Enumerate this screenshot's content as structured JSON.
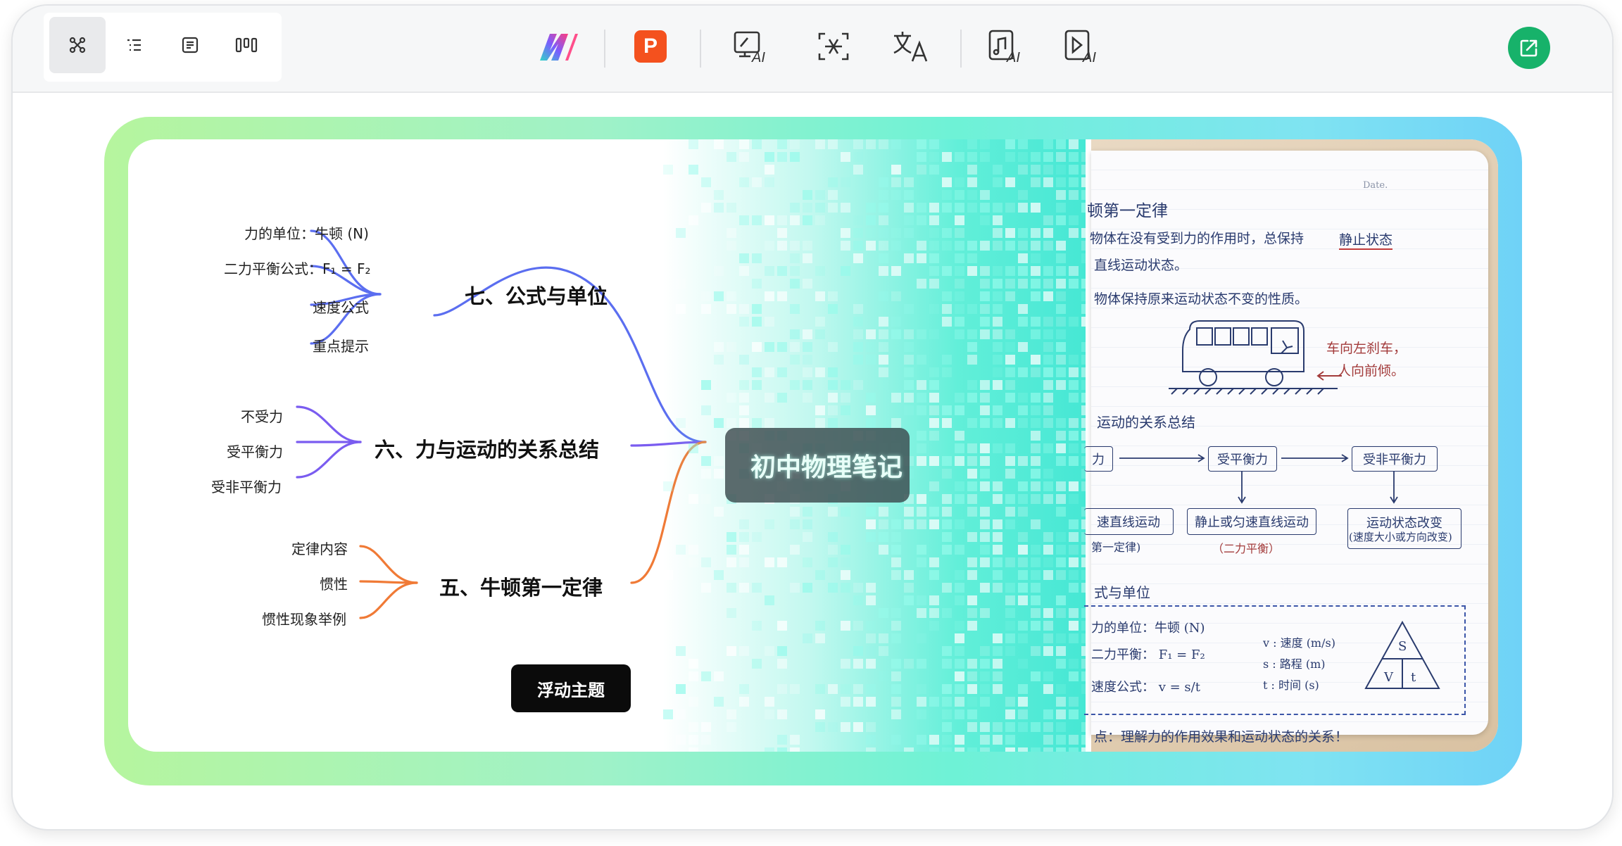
{
  "toolbar": {
    "view_modes": [
      {
        "icon": "mindmap-view-icon",
        "active": true
      },
      {
        "icon": "outline-view-icon",
        "active": false
      },
      {
        "icon": "card-view-icon",
        "active": false
      },
      {
        "icon": "board-view-icon",
        "active": false
      }
    ],
    "tools": [
      {
        "icon": "app-logo-icon"
      },
      {
        "icon": "ppt-icon",
        "label": "P"
      },
      {
        "icon": "ai-generate-icon",
        "badge": "AI"
      },
      {
        "icon": "ocr-scan-icon"
      },
      {
        "icon": "translate-icon"
      },
      {
        "icon": "ai-audio-icon",
        "badge": "AI"
      },
      {
        "icon": "ai-video-icon",
        "badge": "AI"
      }
    ],
    "share_icon": "share-export-icon"
  },
  "colors": {
    "branch7": "#5b6ef0",
    "branch6": "#7a5cf0",
    "branch5": "#f07a36",
    "share": "#17b26a",
    "ppt": "#f4511e"
  },
  "mindmap": {
    "central": "初中物理笔记",
    "branches": [
      {
        "title": "七、公式与单位",
        "leaves": [
          "力的单位：牛顿 (N)",
          "二力平衡公式：F₁ = F₂",
          "速度公式",
          "重点提示"
        ]
      },
      {
        "title": "六、力与运动的关系总结",
        "leaves": [
          "不受力",
          "受平衡力",
          "受非平衡力"
        ]
      },
      {
        "title": "五、牛顿第一定律",
        "leaves": [
          "定律内容",
          "惯性",
          "惯性现象举例"
        ]
      }
    ],
    "floating_topic": "浮动主题"
  },
  "notebook": {
    "date_label": "Date.",
    "heading1": "顿第一定律",
    "line1a": "物体在没有受到力的作用时，总保持",
    "line1b": "静止状态",
    "line2": "直线运动状态。",
    "line3": "物体保持原来运动状态不变的性质。",
    "bus_note1": "车向左刹车，",
    "bus_note2": "人向前倾。",
    "heading2": "运动的关系总结",
    "flow": [
      "力",
      "受平衡力",
      "受非平衡力"
    ],
    "flow_results": [
      "速直线运动",
      "静止或匀速直线运动",
      "运动状态改变"
    ],
    "flow_notes": [
      "第一定律)",
      "（二力平衡）",
      "(速度大小或方向改变)"
    ],
    "heading3": "式与单位",
    "unit_line1": "力的单位：牛顿 (N)",
    "unit_line2": "二力平衡： F₁ = F₂",
    "unit_line3": "速度公式： v = s/t",
    "var_v": "v : 速度 (m/s)",
    "var_s": "s : 路程 (m)",
    "var_t": "t : 时间 (s)",
    "tri_s": "S",
    "tri_v": "V",
    "tri_t": "t",
    "footer": "点：理解力的作用效果和运动状态的关系！"
  }
}
